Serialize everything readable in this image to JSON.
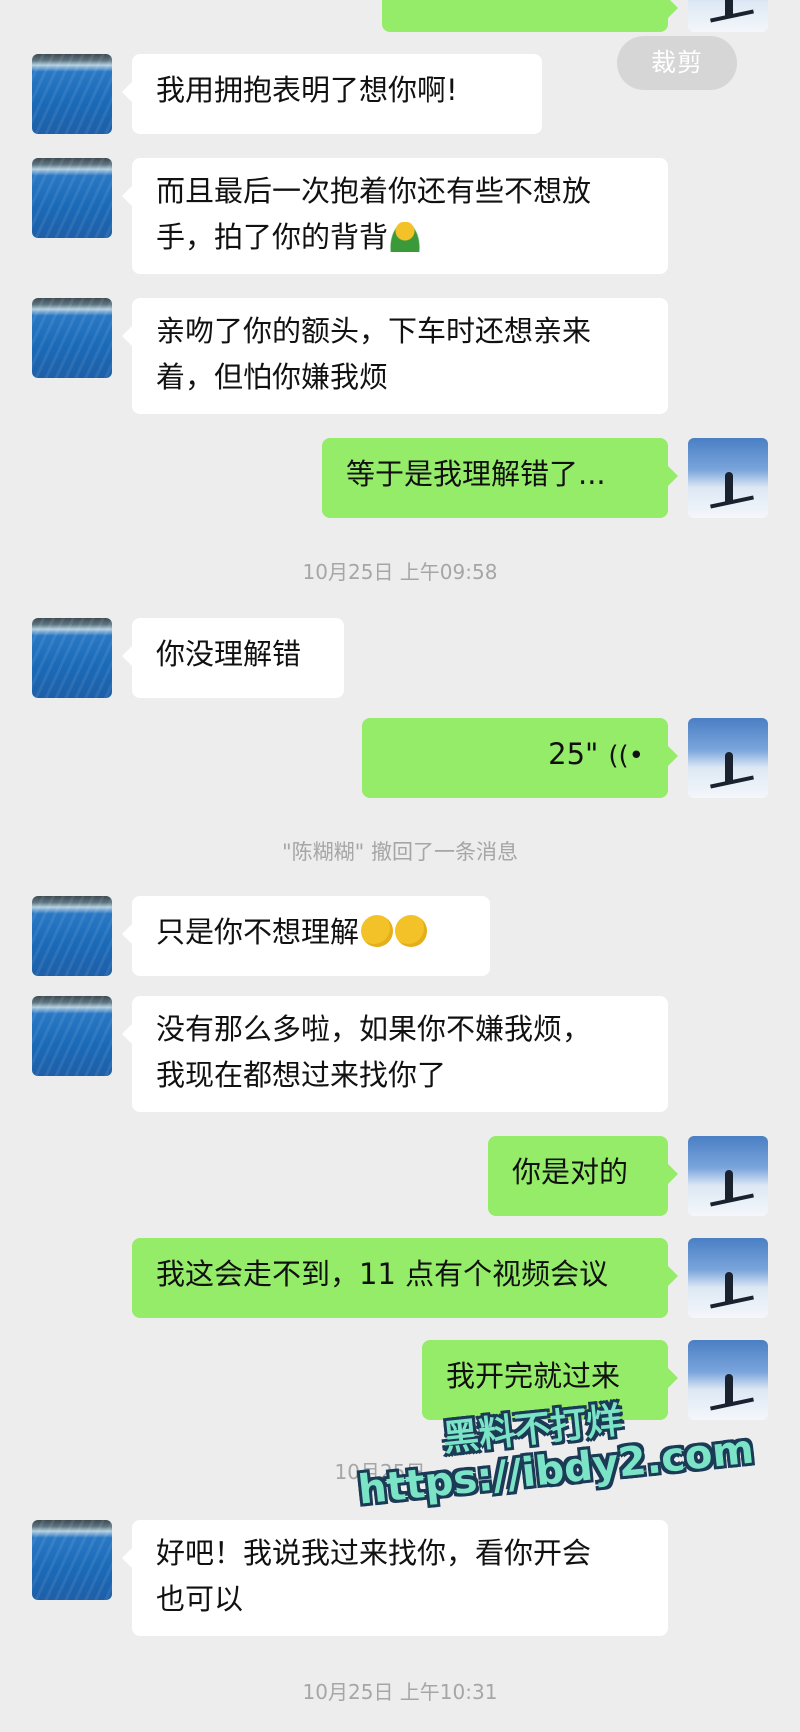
{
  "toolbar": {
    "crop_label": "裁剪"
  },
  "messages": [
    {
      "text": "我用拥抱表明了想你啊!"
    },
    {
      "text_line1": "而且最后一次抱着你还有些不想放",
      "text_line2": "手，拍了你的背背"
    },
    {
      "text_line1": "亲吻了你的额头，下车时还想亲来",
      "text_line2": "着，但怕你嫌我烦"
    },
    {
      "text": "等于是我理解错了..."
    },
    {
      "text": "你没理解错"
    },
    {
      "duration": "25\""
    },
    {
      "text": "只是你不想理解"
    },
    {
      "text_line1": "没有那么多啦，如果你不嫌我烦，",
      "text_line2": "我现在都想过来找你了"
    },
    {
      "text": "你是对的"
    },
    {
      "text": "我这会走不到，11 点有个视频会议"
    },
    {
      "text": "我开完就过来"
    },
    {
      "text_line1": "好吧！我说我过来找你，看你开会",
      "text_line2": "也可以"
    }
  ],
  "timestamps": [
    "10月25日 上午09:58",
    "10月25日",
    "10月25日 上午10:31"
  ],
  "system_notice": "\"陈糊糊\" 撤回了一条消息",
  "watermark": {
    "line1": "黑料不打烊",
    "line2": "https://ibdy2.com"
  }
}
